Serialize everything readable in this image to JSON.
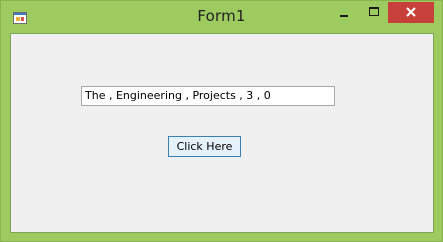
{
  "window": {
    "title": "Form1",
    "icon": "form-app-icon",
    "controls": {
      "minimize_icon": "minimize-icon",
      "maximize_icon": "maximize-icon",
      "close_icon": "close-icon"
    }
  },
  "form": {
    "textbox_value": "The , Engineering , Projects , 3 , 0",
    "button_label": "Click Here"
  },
  "colors": {
    "frame": "#9dcb5f",
    "client_background": "#f0f0f0",
    "close_button": "#c7413a",
    "button_border": "#3c7fb1"
  }
}
